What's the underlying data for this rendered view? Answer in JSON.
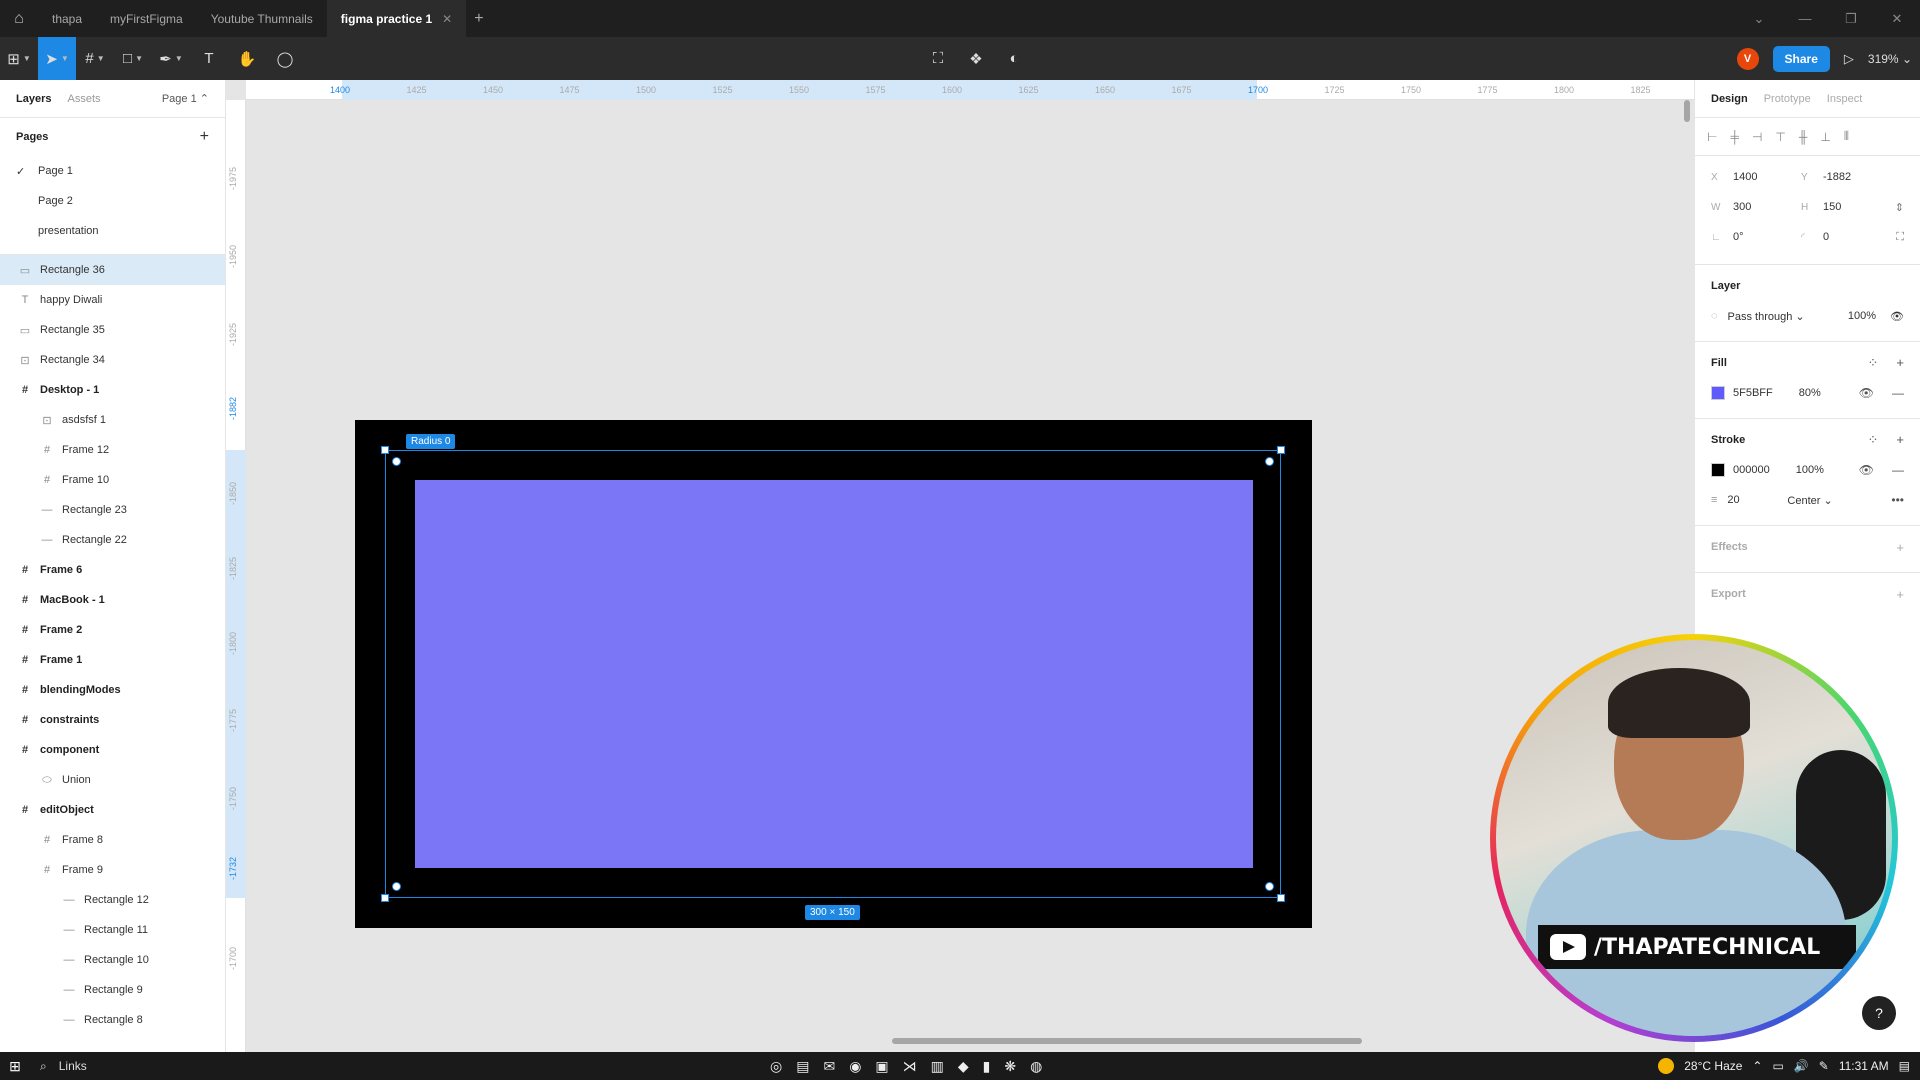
{
  "tabs": [
    {
      "label": "thapa"
    },
    {
      "label": "myFirstFigma"
    },
    {
      "label": "Youtube Thumnails"
    },
    {
      "label": "figma practice 1"
    }
  ],
  "toolbar": {
    "avatar_initial": "V",
    "share_label": "Share",
    "zoom": "319%"
  },
  "left": {
    "tab_layers": "Layers",
    "tab_assets": "Assets",
    "page_selector": "Page 1",
    "pages_title": "Pages",
    "pages": [
      "Page 1",
      "Page 2",
      "presentation"
    ],
    "layers": [
      {
        "label": "Rectangle 36",
        "icon": "rectangle-icon"
      },
      {
        "label": "happy Diwali",
        "icon": "text-icon"
      },
      {
        "label": "Rectangle 35",
        "icon": "rectangle-icon"
      },
      {
        "label": "Rectangle 34",
        "icon": "image-icon"
      },
      {
        "label": "Desktop - 1",
        "icon": "frame-icon"
      },
      {
        "label": "asdsfsf 1",
        "icon": "image-icon"
      },
      {
        "label": "Frame 12",
        "icon": "frame-icon"
      },
      {
        "label": "Frame 10",
        "icon": "frame-icon"
      },
      {
        "label": "Rectangle 23",
        "icon": "line-icon"
      },
      {
        "label": "Rectangle 22",
        "icon": "line-icon"
      },
      {
        "label": "Frame 6",
        "icon": "frame-icon"
      },
      {
        "label": "MacBook - 1",
        "icon": "frame-icon"
      },
      {
        "label": "Frame 2",
        "icon": "frame-icon"
      },
      {
        "label": "Frame 1",
        "icon": "frame-icon"
      },
      {
        "label": "blendingModes",
        "icon": "frame-icon"
      },
      {
        "label": "constraints",
        "icon": "frame-icon"
      },
      {
        "label": "component",
        "icon": "frame-icon"
      },
      {
        "label": "Union",
        "icon": "union-icon"
      },
      {
        "label": "editObject",
        "icon": "frame-icon"
      },
      {
        "label": "Frame 8",
        "icon": "frame-icon"
      },
      {
        "label": "Frame 9",
        "icon": "frame-icon"
      },
      {
        "label": "Rectangle 12",
        "icon": "line-icon"
      },
      {
        "label": "Rectangle 11",
        "icon": "line-icon"
      },
      {
        "label": "Rectangle 10",
        "icon": "line-icon"
      },
      {
        "label": "Rectangle 9",
        "icon": "line-icon"
      },
      {
        "label": "Rectangle 8",
        "icon": "line-icon"
      }
    ]
  },
  "canvas": {
    "ruler_top": [
      "1400",
      "1425",
      "1450",
      "1475",
      "1500",
      "1525",
      "1550",
      "1575",
      "1600",
      "1625",
      "1650",
      "1675",
      "1700",
      "1725",
      "1750",
      "1775",
      "1800",
      "1825"
    ],
    "ruler_top_hl_start": "1400",
    "ruler_top_hl_end": "1700",
    "ruler_left": [
      "-1975",
      "-1950",
      "-1925",
      "-1882",
      "-1850",
      "-1825",
      "-1800",
      "-1775",
      "-1750",
      "-1732",
      "-1700"
    ],
    "radius_tag": "Radius 0",
    "size_tag": "300 × 150"
  },
  "right": {
    "tab_design": "Design",
    "tab_prototype": "Prototype",
    "tab_inspect": "Inspect",
    "x_label": "X",
    "x": "1400",
    "y_label": "Y",
    "y": "-1882",
    "w_label": "W",
    "w": "300",
    "h_label": "H",
    "h": "150",
    "rotation": "0°",
    "corner": "0",
    "layer_title": "Layer",
    "blend": "Pass through",
    "opacity": "100%",
    "fill_title": "Fill",
    "fill_hex": "5F5BFF",
    "fill_opacity": "80%",
    "fill_color": "#5F5BFF",
    "stroke_title": "Stroke",
    "stroke_hex": "000000",
    "stroke_opacity": "100%",
    "stroke_color": "#000000",
    "stroke_width": "20",
    "stroke_align": "Center",
    "effects_title": "Effects",
    "export_title": "Export"
  },
  "webcam": {
    "channel": "/THAPATECHNICAL"
  },
  "taskbar": {
    "search": "Links",
    "weather": "28°C Haze",
    "time": "11:31 AM"
  }
}
